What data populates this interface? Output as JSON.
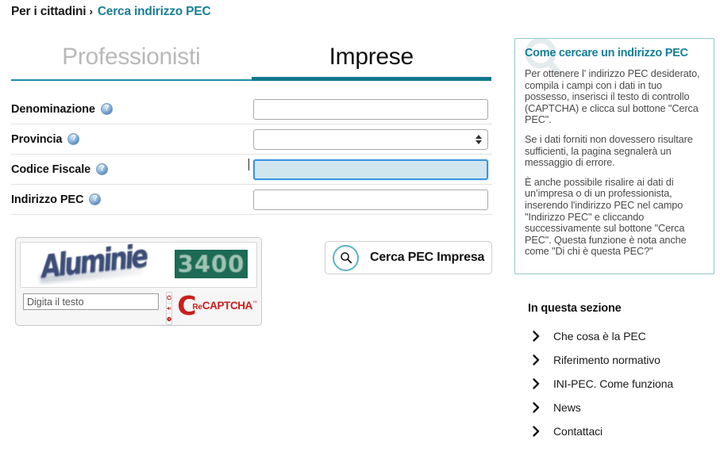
{
  "breadcrumb": {
    "root": "Per i cittadini",
    "separator": "›",
    "current": "Cerca indirizzo PEC"
  },
  "tabs": [
    {
      "label": "Professionisti",
      "active": false
    },
    {
      "label": "Imprese",
      "active": true
    }
  ],
  "form": {
    "help_icon": "help-question-icon",
    "rows": [
      {
        "label": "Denominazione",
        "type": "text",
        "value": "",
        "focused": false
      },
      {
        "label": "Provincia",
        "type": "select",
        "value": "",
        "focused": false
      },
      {
        "label": "Codice Fiscale",
        "type": "text",
        "value": "",
        "focused": true
      },
      {
        "label": "Indirizzo PEC",
        "type": "text",
        "value": "",
        "focused": false
      }
    ]
  },
  "captcha": {
    "word": "Aluminie",
    "digits": "3400",
    "input_placeholder": "Digita il testo",
    "input_value": "",
    "tools": [
      {
        "name": "refresh-icon",
        "title": "Ricarica"
      },
      {
        "name": "audio-icon",
        "title": "Audio"
      },
      {
        "name": "help-icon",
        "title": "Aiuto"
      }
    ],
    "logo": {
      "c": "C",
      "re": "Re",
      "captcha": "CAPTCHA",
      "tm": "™"
    }
  },
  "search_button": {
    "icon": "search-icon",
    "label": "Cerca PEC Impresa"
  },
  "info_panel": {
    "title": "Come cercare un indirizzo PEC",
    "paragraphs": [
      "Per ottenere l' indirizzo PEC desiderato, compila i campi con i dati in tuo possesso, inserisci il testo di controllo (CAPTCHA) e clicca sul bottone \"Cerca PEC\".",
      "Se i dati forniti non dovessero risultare sufficienti, la pagina segnalerà un messaggio di errore.",
      "È anche possibile risalire ai dati di un’impresa o di un professionista, inserendo l'indirizzo PEC nel campo \"Indirizzo PEC\" e cliccando successivamente  sul bottone \"Cerca PEC\". Questa funzione è nota anche come \"Di chi è questa PEC?\""
    ]
  },
  "section": {
    "title": "In questa sezione",
    "links": [
      {
        "label": "Che cosa è la PEC"
      },
      {
        "label": "Riferimento normativo"
      },
      {
        "label": "INI-PEC. Come funziona"
      },
      {
        "label": "News"
      },
      {
        "label": "Contattaci"
      }
    ]
  }
}
